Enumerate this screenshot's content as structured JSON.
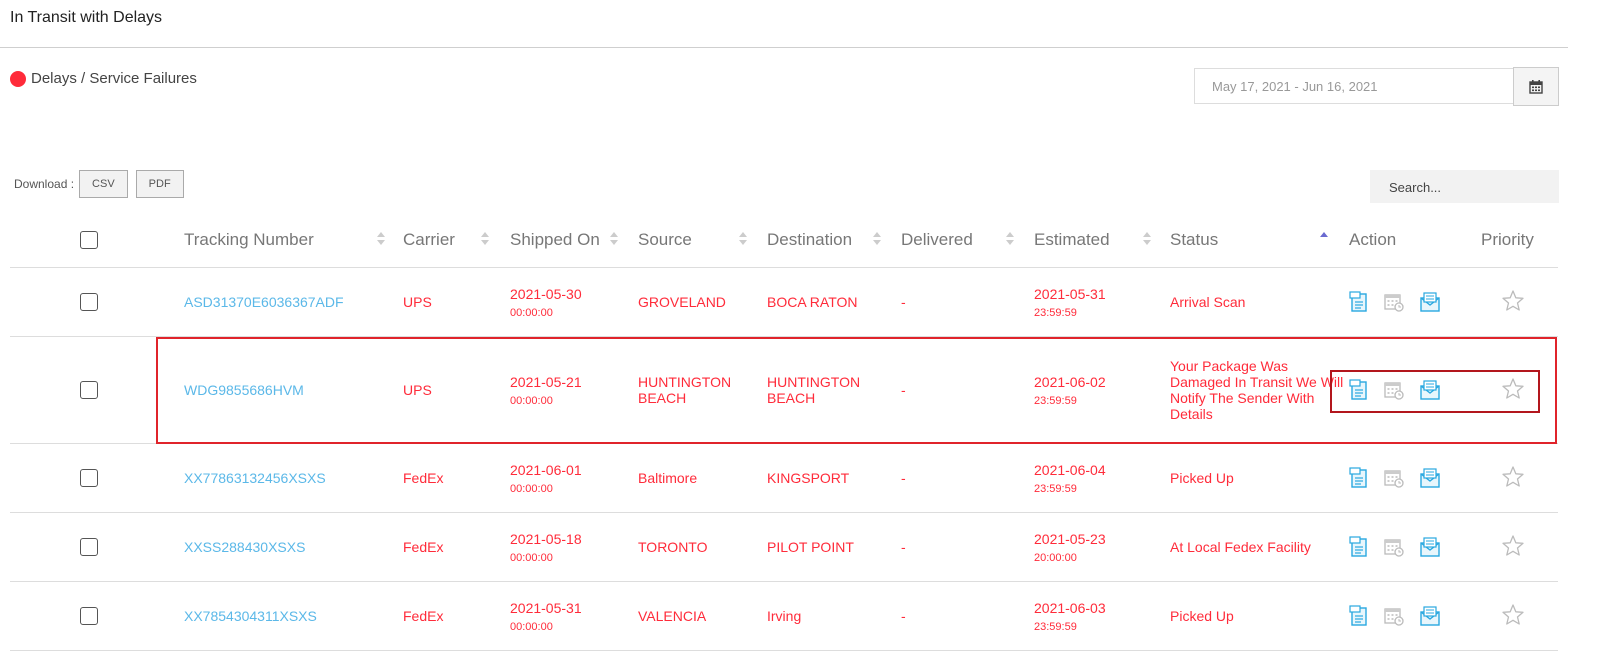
{
  "page": {
    "title": "In Transit with Delays"
  },
  "legend": {
    "label": "Delays / Service Failures",
    "color": "#ff2b3a"
  },
  "date_range": {
    "value": "May 17, 2021 - Jun 16, 2021",
    "button_icon": "calendar-icon"
  },
  "download": {
    "label": "Download :",
    "csv": "CSV",
    "pdf": "PDF"
  },
  "search": {
    "placeholder": "Search..."
  },
  "table": {
    "headers": [
      "Tracking Number",
      "Carrier",
      "Shipped On",
      "Source",
      "Destination",
      "Delivered",
      "Estimated",
      "Status",
      "Action",
      "Priority"
    ],
    "rows": [
      {
        "tracking": "ASD31370E6036367ADF",
        "carrier": "UPS",
        "shipped_date": "2021-05-30",
        "shipped_time": "00:00:00",
        "source": "GROVELAND",
        "destination": "BOCA RATON",
        "delivered": "-",
        "est_date": "2021-05-31",
        "est_time": "23:59:59",
        "status": "Arrival Scan"
      },
      {
        "tracking": "WDG9855686HVM",
        "carrier": "UPS",
        "shipped_date": "2021-05-21",
        "shipped_time": "00:00:00",
        "source": "HUNTINGTON BEACH",
        "destination": "HUNTINGTON BEACH",
        "delivered": "-",
        "est_date": "2021-06-02",
        "est_time": "23:59:59",
        "status": "Your Package Was Damaged In Transit We Will Notify The Sender With Details"
      },
      {
        "tracking": "XX77863132456XSXS",
        "carrier": "FedEx",
        "shipped_date": "2021-06-01",
        "shipped_time": "00:00:00",
        "source": "Baltimore",
        "destination": "KINGSPORT",
        "delivered": "-",
        "est_date": "2021-06-04",
        "est_time": "23:59:59",
        "status": "Picked Up"
      },
      {
        "tracking": "XXSS288430XSXS",
        "carrier": "FedEx",
        "shipped_date": "2021-05-18",
        "shipped_time": "00:00:00",
        "source": "TORONTO",
        "destination": "PILOT POINT",
        "delivered": "-",
        "est_date": "2021-05-23",
        "est_time": "20:00:00",
        "status": "At Local Fedex Facility"
      },
      {
        "tracking": "XX7854304311XSXS",
        "carrier": "FedEx",
        "shipped_date": "2021-05-31",
        "shipped_time": "00:00:00",
        "source": "VALENCIA",
        "destination": "Irving",
        "delivered": "-",
        "est_date": "2021-06-03",
        "est_time": "23:59:59",
        "status": "Picked Up"
      }
    ]
  },
  "colors": {
    "accent_red": "#ff2b3a",
    "link_blue": "#5bb8e8",
    "highlight": "#e0242b"
  }
}
